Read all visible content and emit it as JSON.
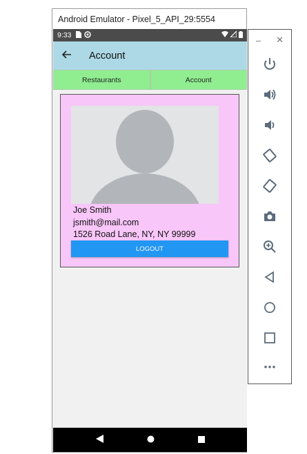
{
  "window": {
    "title": "Android Emulator - Pixel_5_API_29:5554"
  },
  "status_bar": {
    "time": "9:33"
  },
  "app_bar": {
    "title": "Account",
    "back_icon": "arrow-left-icon"
  },
  "tabs": [
    {
      "label": "Restaurants"
    },
    {
      "label": "Account"
    }
  ],
  "profile": {
    "name": "Joe Smith",
    "email": "jsmith@mail.com",
    "address": "1526 Road Lane, NY, NY 99999",
    "logout_label": "LOGOUT"
  },
  "colors": {
    "app_bar": "#add8e6",
    "tab_bg": "#90ee90",
    "card_bg": "#f8c6f8",
    "logout_button": "#2196f3",
    "status_bar": "#4b4b4b"
  },
  "side_toolbar": {
    "icons": [
      "power-icon",
      "volume-up-icon",
      "volume-down-icon",
      "rotate-left-icon",
      "rotate-right-icon",
      "camera-icon",
      "zoom-in-icon",
      "back-icon",
      "home-icon",
      "overview-icon",
      "more-icon"
    ]
  }
}
